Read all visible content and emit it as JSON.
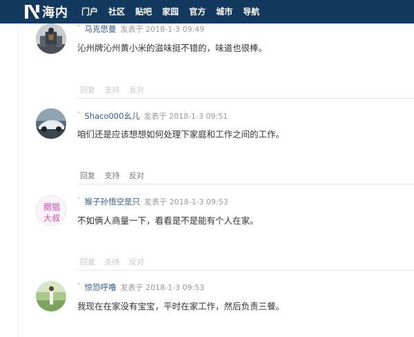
{
  "header": {
    "logo_text": "海内",
    "nav": [
      "门户",
      "社区",
      "贴吧",
      "家园",
      "官方",
      "城市",
      "导航"
    ]
  },
  "colors": {
    "header_bg": "#14395f",
    "username": "#335a8a"
  },
  "posts": [
    {
      "username": "马克思曼",
      "posted_label": "发表于",
      "time": "2018-1-3 09:49",
      "content": "沁州牌沁州黄小米的滋味挺不错的，味道也很棒。",
      "actions": [
        "回复",
        "支持",
        "反对"
      ],
      "avatar_icon": "robot-avatar-icon"
    },
    {
      "username": "Shaco000幺儿",
      "posted_label": "发表于",
      "time": "2018-1-3 09:51",
      "content": "咱们还是应该想想如何处理下家庭和工作之间的工作。",
      "actions": [
        "回复",
        "支持",
        "反对"
      ],
      "avatar_icon": "car-avatar-icon"
    },
    {
      "username": "猴子孙悟空是只",
      "posted_label": "发表于",
      "time": "2018-1-3 09:53",
      "content": "不如俩人商量一下，看看是不是能有个人在家。",
      "actions": [
        "回复",
        "支持",
        "反对"
      ],
      "avatar_icon": "text-avatar-icon",
      "avatar_text": "腮猖大叔"
    },
    {
      "username": "惊恐呼噜",
      "posted_label": "发表于",
      "time": "2018-1-3 09:53",
      "content": "我现在在家没有宝宝，平时在家工作，然后负责三餐。",
      "avatar_icon": "nature-avatar-icon"
    }
  ]
}
